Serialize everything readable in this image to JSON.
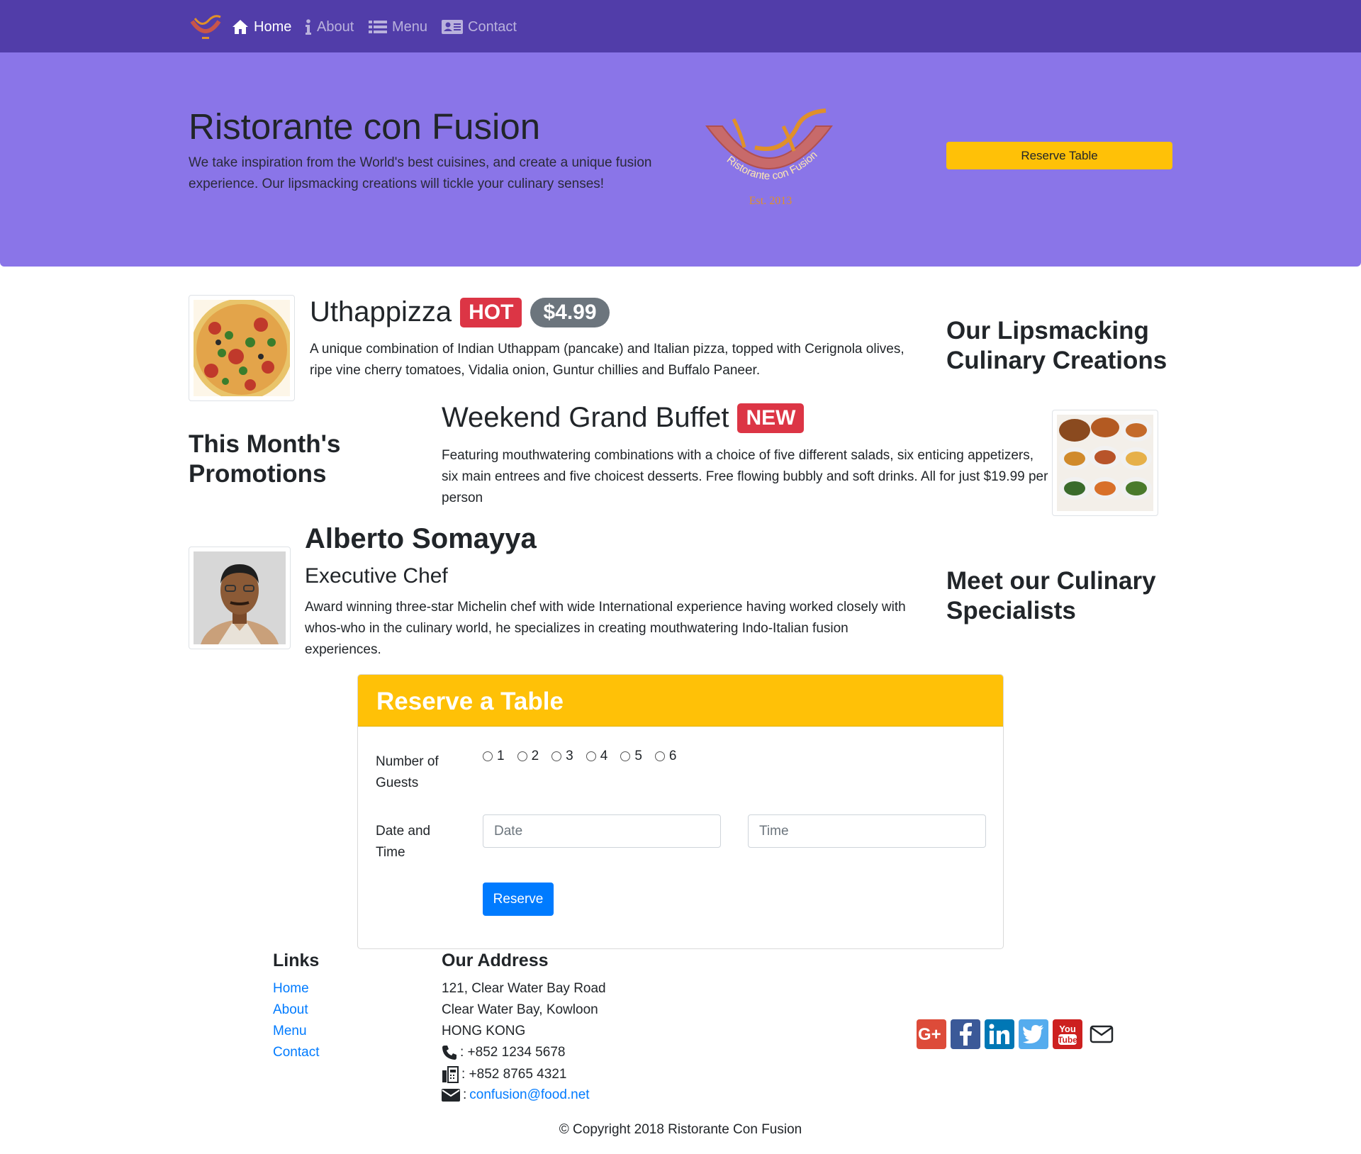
{
  "nav": {
    "logo_icon": "restaurant-logo",
    "items": [
      {
        "label": "Home",
        "icon": "home-icon"
      },
      {
        "label": "About",
        "icon": "info-icon"
      },
      {
        "label": "Menu",
        "icon": "list-icon"
      },
      {
        "label": "Contact",
        "icon": "address-card-icon"
      }
    ]
  },
  "hero": {
    "title": "Ristorante con Fusion",
    "text": "We take inspiration from the World's best cuisines, and create a unique fusion experience. Our lipsmacking creations will tickle your culinary senses!",
    "logo_text": "Ristorante con Fusion",
    "logo_est": "Est. 2013",
    "button": "Reserve Table"
  },
  "dish": {
    "name": "Uthappizza",
    "badge": "HOT",
    "price": "$4.99",
    "description": "A unique combination of Indian Uthappam (pancake) and Italian pizza, topped with Cerignola olives, ripe vine cherry tomatoes, Vidalia onion, Guntur chillies and Buffalo Paneer.",
    "side_heading": "Our Lipsmacking Culinary Creations"
  },
  "promotion": {
    "name": "Weekend Grand Buffet",
    "badge": "NEW",
    "description": "Featuring mouthwatering combinations with a choice of five different salads, six enticing appetizers, six main entrees and five choicest desserts. Free flowing bubbly and soft drinks. All for just $19.99 per person",
    "side_heading": "This Month's Promotions"
  },
  "leader": {
    "name": "Alberto Somayya",
    "designation": "Executive Chef",
    "description": "Award winning three-star Michelin chef with wide International experience having worked closely with whos-who in the culinary world, he specializes in creating mouthwatering Indo-Italian fusion experiences.",
    "side_heading": "Meet our Culinary Specialists"
  },
  "reserve": {
    "title": "Reserve a Table",
    "guests_label": "Number of Guests",
    "guest_options": [
      "1",
      "2",
      "3",
      "4",
      "5",
      "6"
    ],
    "datetime_label": "Date and Time",
    "date_placeholder": "Date",
    "time_placeholder": "Time",
    "button": "Reserve"
  },
  "footer": {
    "links_heading": "Links",
    "links": [
      "Home",
      "About",
      "Menu",
      "Contact"
    ],
    "address_heading": "Our Address",
    "address_lines": [
      "121, Clear Water Bay Road",
      "Clear Water Bay, Kowloon",
      "HONG KONG"
    ],
    "phone": ": +852 1234 5678",
    "fax": ": +852 8765 4321",
    "email_prefix": ":",
    "email": "confusion@food.net",
    "social": [
      "google-plus-icon",
      "facebook-icon",
      "linkedin-icon",
      "twitter-icon",
      "youtube-icon",
      "envelope-icon"
    ],
    "copyright": "© Copyright 2018 Ristorante Con Fusion"
  },
  "colors": {
    "navbar": "#513da9",
    "jumbotron": "#8a75e8",
    "warning": "#ffc107",
    "primary": "#007bff",
    "danger": "#dc3545",
    "secondary": "#6c757d"
  }
}
